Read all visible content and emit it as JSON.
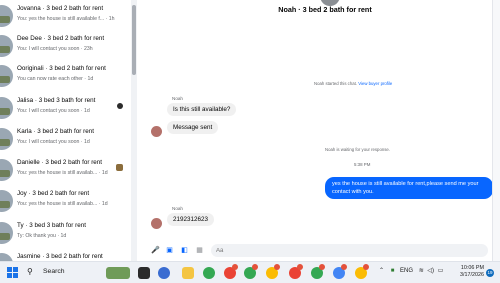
{
  "conversations": [
    {
      "name": "Jovanna · 3 bed 2 bath for rent",
      "preview": "You: yes the house is still available f... · 1h"
    },
    {
      "name": "Dee Dee · 3 bed 2 bath for rent",
      "preview": "You: I will contact you soon · 23h"
    },
    {
      "name": "Ooriginali · 3 bed 2 bath for rent",
      "preview": "You can now rate each other · 1d"
    },
    {
      "name": "Jalisa · 3 bed 3 bath for rent",
      "preview": "You: I will contact you soon · 1d"
    },
    {
      "name": "Karla · 3 bed 2 bath for rent",
      "preview": "You: I will contact you soon · 1d"
    },
    {
      "name": "Danielle · 3 bed 2 bath for rent",
      "preview": "You: yes the house is still availab... · 1d"
    },
    {
      "name": "Joy · 3 bed 2 bath for rent",
      "preview": "You: yes the house is still availab... · 1d"
    },
    {
      "name": "Ty · 3 bed 3 bath for rent",
      "preview": "Ty: Ok thank you · 1d"
    },
    {
      "name": "Jasmine · 3 bed 2 bath for rent",
      "preview": ""
    }
  ],
  "chat": {
    "title": "Noah · 3 bed 2 bath for rent",
    "started_text": "Noah started this chat.",
    "buyer_profile_link": "View buyer profile",
    "sender_name": "Noah",
    "msg1": "Is this still available?",
    "msg2": "Message sent",
    "waiting_text": "Noah is waiting for your response.",
    "timestamp": "5:38 PM",
    "out_msg": "yes the house is still available for rent,please send me your contact with you.",
    "sender_name2": "Noah",
    "msg3": "2192312623",
    "input_placeholder": "Aa"
  },
  "taskbar": {
    "search_label": "Search",
    "tray_lang": "ENG",
    "time": "10:06 PM",
    "date": "3/17/2026",
    "notification_count": "19"
  },
  "colors": {
    "accent": "#0866ff",
    "incoming_bubble": "#f0f0f0",
    "taskbar": "#eef1f6"
  }
}
